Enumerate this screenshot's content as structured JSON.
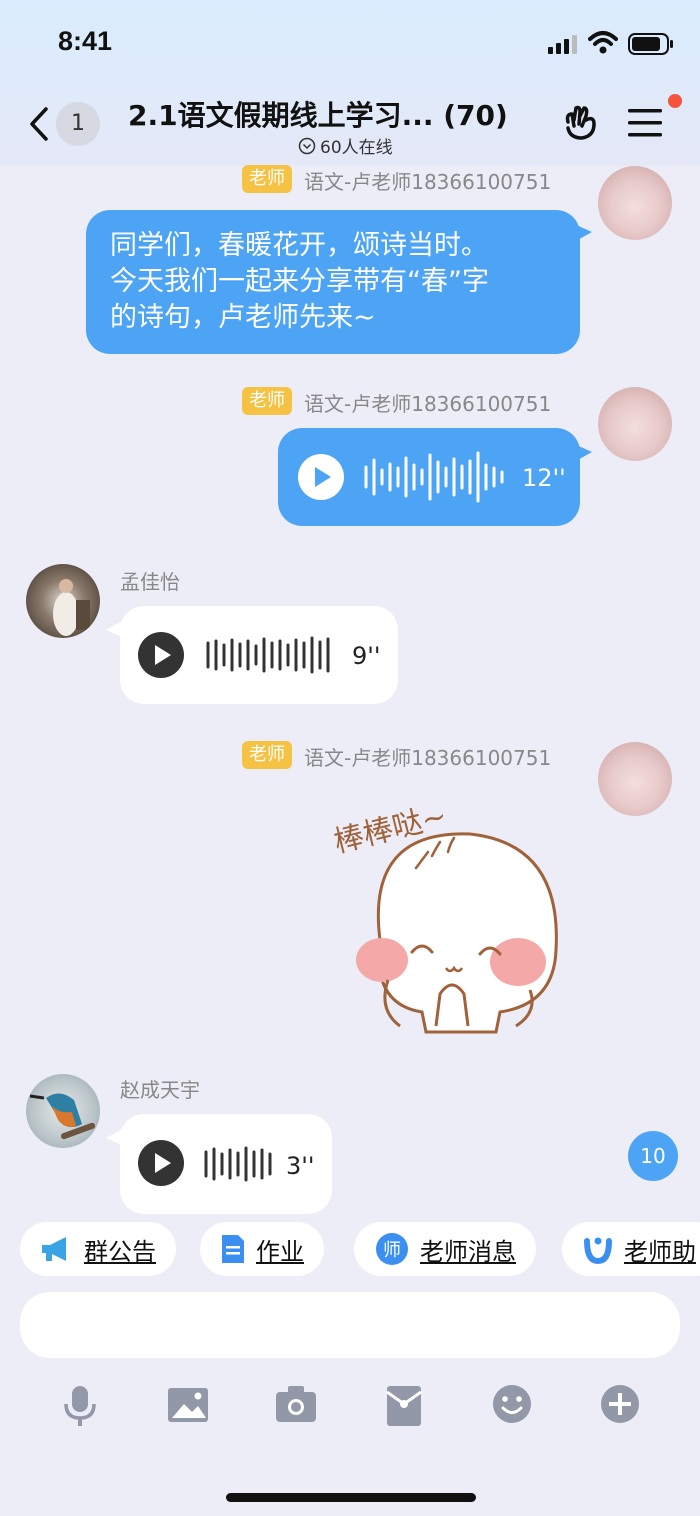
{
  "status_bar": {
    "time": "8:41"
  },
  "header": {
    "back_count": "1",
    "title": "2.1语文假期线上学习... (70)",
    "online": "60人在线"
  },
  "messages": [
    {
      "tag": "老师",
      "sender": "语文-卢老师18366100751",
      "text_lines": [
        "同学们，春暖花开，颂诗当时。",
        "今天我们一起来分享带有“春”字",
        "的诗句，卢老师先来~"
      ]
    },
    {
      "tag": "老师",
      "sender": "语文-卢老师18366100751",
      "duration": "12''"
    },
    {
      "sender": "孟佳怡",
      "duration": "9''"
    },
    {
      "tag": "老师",
      "sender": "语文-卢老师18366100751",
      "sticker_text": "棒棒哒~"
    },
    {
      "sender": "赵成天宇",
      "duration": "3''"
    }
  ],
  "new_message_count": "10",
  "quick_actions": [
    {
      "label": "群公告",
      "icon": "megaphone-icon"
    },
    {
      "label": "作业",
      "icon": "document-icon"
    },
    {
      "label": "老师消息",
      "icon": "teacher-icon"
    },
    {
      "label": "老师助",
      "icon": "assistant-icon"
    }
  ],
  "toolbar": [
    "microphone-icon",
    "image-icon",
    "camera-icon",
    "red-packet-icon",
    "emoji-icon",
    "plus-icon"
  ],
  "colors": {
    "blue_bubble": "#4da4f4",
    "teacher_tag": "#f5c244",
    "background": "#ecedf7"
  }
}
